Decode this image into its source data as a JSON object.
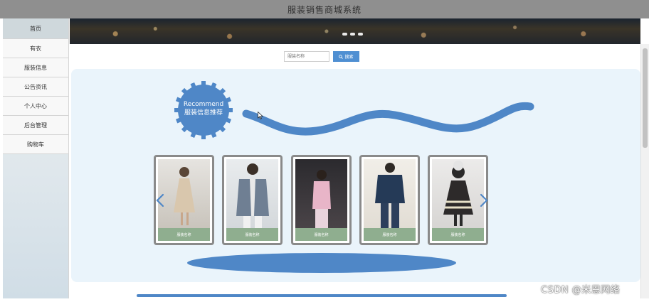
{
  "app": {
    "title": "服装销售商城系统"
  },
  "sidebar": {
    "items": [
      {
        "label": "首页",
        "active": true
      },
      {
        "label": "有衣"
      },
      {
        "label": "服装信息"
      },
      {
        "label": "公告资讯"
      },
      {
        "label": "个人中心"
      },
      {
        "label": "后台管理"
      },
      {
        "label": "购物车"
      }
    ]
  },
  "search": {
    "placeholder": "服装名称",
    "button_label": "搜索"
  },
  "recommend": {
    "title_en": "Recommend",
    "title_cn": "服装信息推荐"
  },
  "products": [
    {
      "caption": "服装名称",
      "icon": "dress-photo"
    },
    {
      "caption": "服装名称",
      "icon": "blazer-photo"
    },
    {
      "caption": "服装名称",
      "icon": "pink-jacket-photo"
    },
    {
      "caption": "服装名称",
      "icon": "suit-photo"
    },
    {
      "caption": "服装名称",
      "icon": "kids-dress-photo"
    }
  ],
  "watermark": "CSDN @米恩网络",
  "colors": {
    "accent": "#4f87c7",
    "titlebar": "#8f8f8f",
    "caption": "#8fae8f",
    "panel": "#eaf4fb"
  }
}
